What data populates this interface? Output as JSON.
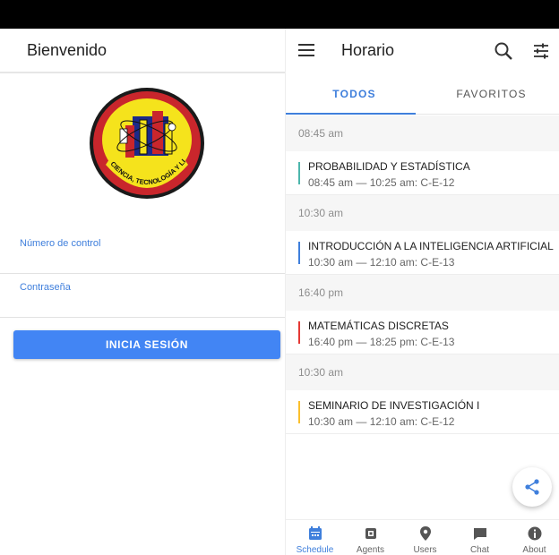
{
  "login": {
    "title": "Bienvenido",
    "logo_text": "CIENCIA, TECNOLOGÍA Y LIBERTAD",
    "field_control_label": "Número de control",
    "field_password_label": "Contraseña",
    "login_button": "INICIA SESIÓN"
  },
  "schedule": {
    "title": "Horario",
    "tabs": [
      {
        "label": "TODOS"
      },
      {
        "label": "FAVORITOS"
      }
    ],
    "sessions": [
      {
        "header": "08:45 am",
        "name": "PROBABILIDAD Y ESTADÍSTICA",
        "meta": "08:45 am — 10:25 am: C-E-12",
        "color": "#4db6ac"
      },
      {
        "header": "10:30 am",
        "name": "INTRODUCCIÓN A LA INTELIGENCIA ARTIFICIAL",
        "meta": "10:30 am — 12:10 am: C-E-13",
        "color": "#3f7fdc"
      },
      {
        "header": "16:40 pm",
        "name": "MATEMÁTICAS DISCRETAS",
        "meta": "16:40 pm — 18:25 pm: C-E-13",
        "color": "#e53935"
      },
      {
        "header": "10:30 am",
        "name": "SEMINARIO DE INVESTIGACIÓN I",
        "meta": "10:30 am — 12:10 am: C-E-12",
        "color": "#fbc02d"
      }
    ],
    "nav": [
      {
        "label": "Schedule",
        "icon": "calendar-icon",
        "active": true
      },
      {
        "label": "Agents",
        "icon": "chip-icon"
      },
      {
        "label": "Users",
        "icon": "location-pin-icon"
      },
      {
        "label": "Chat",
        "icon": "chat-icon"
      },
      {
        "label": "About",
        "icon": "info-icon"
      }
    ]
  },
  "colors": {
    "accent": "#3f7fdc",
    "button": "#4285f4"
  }
}
